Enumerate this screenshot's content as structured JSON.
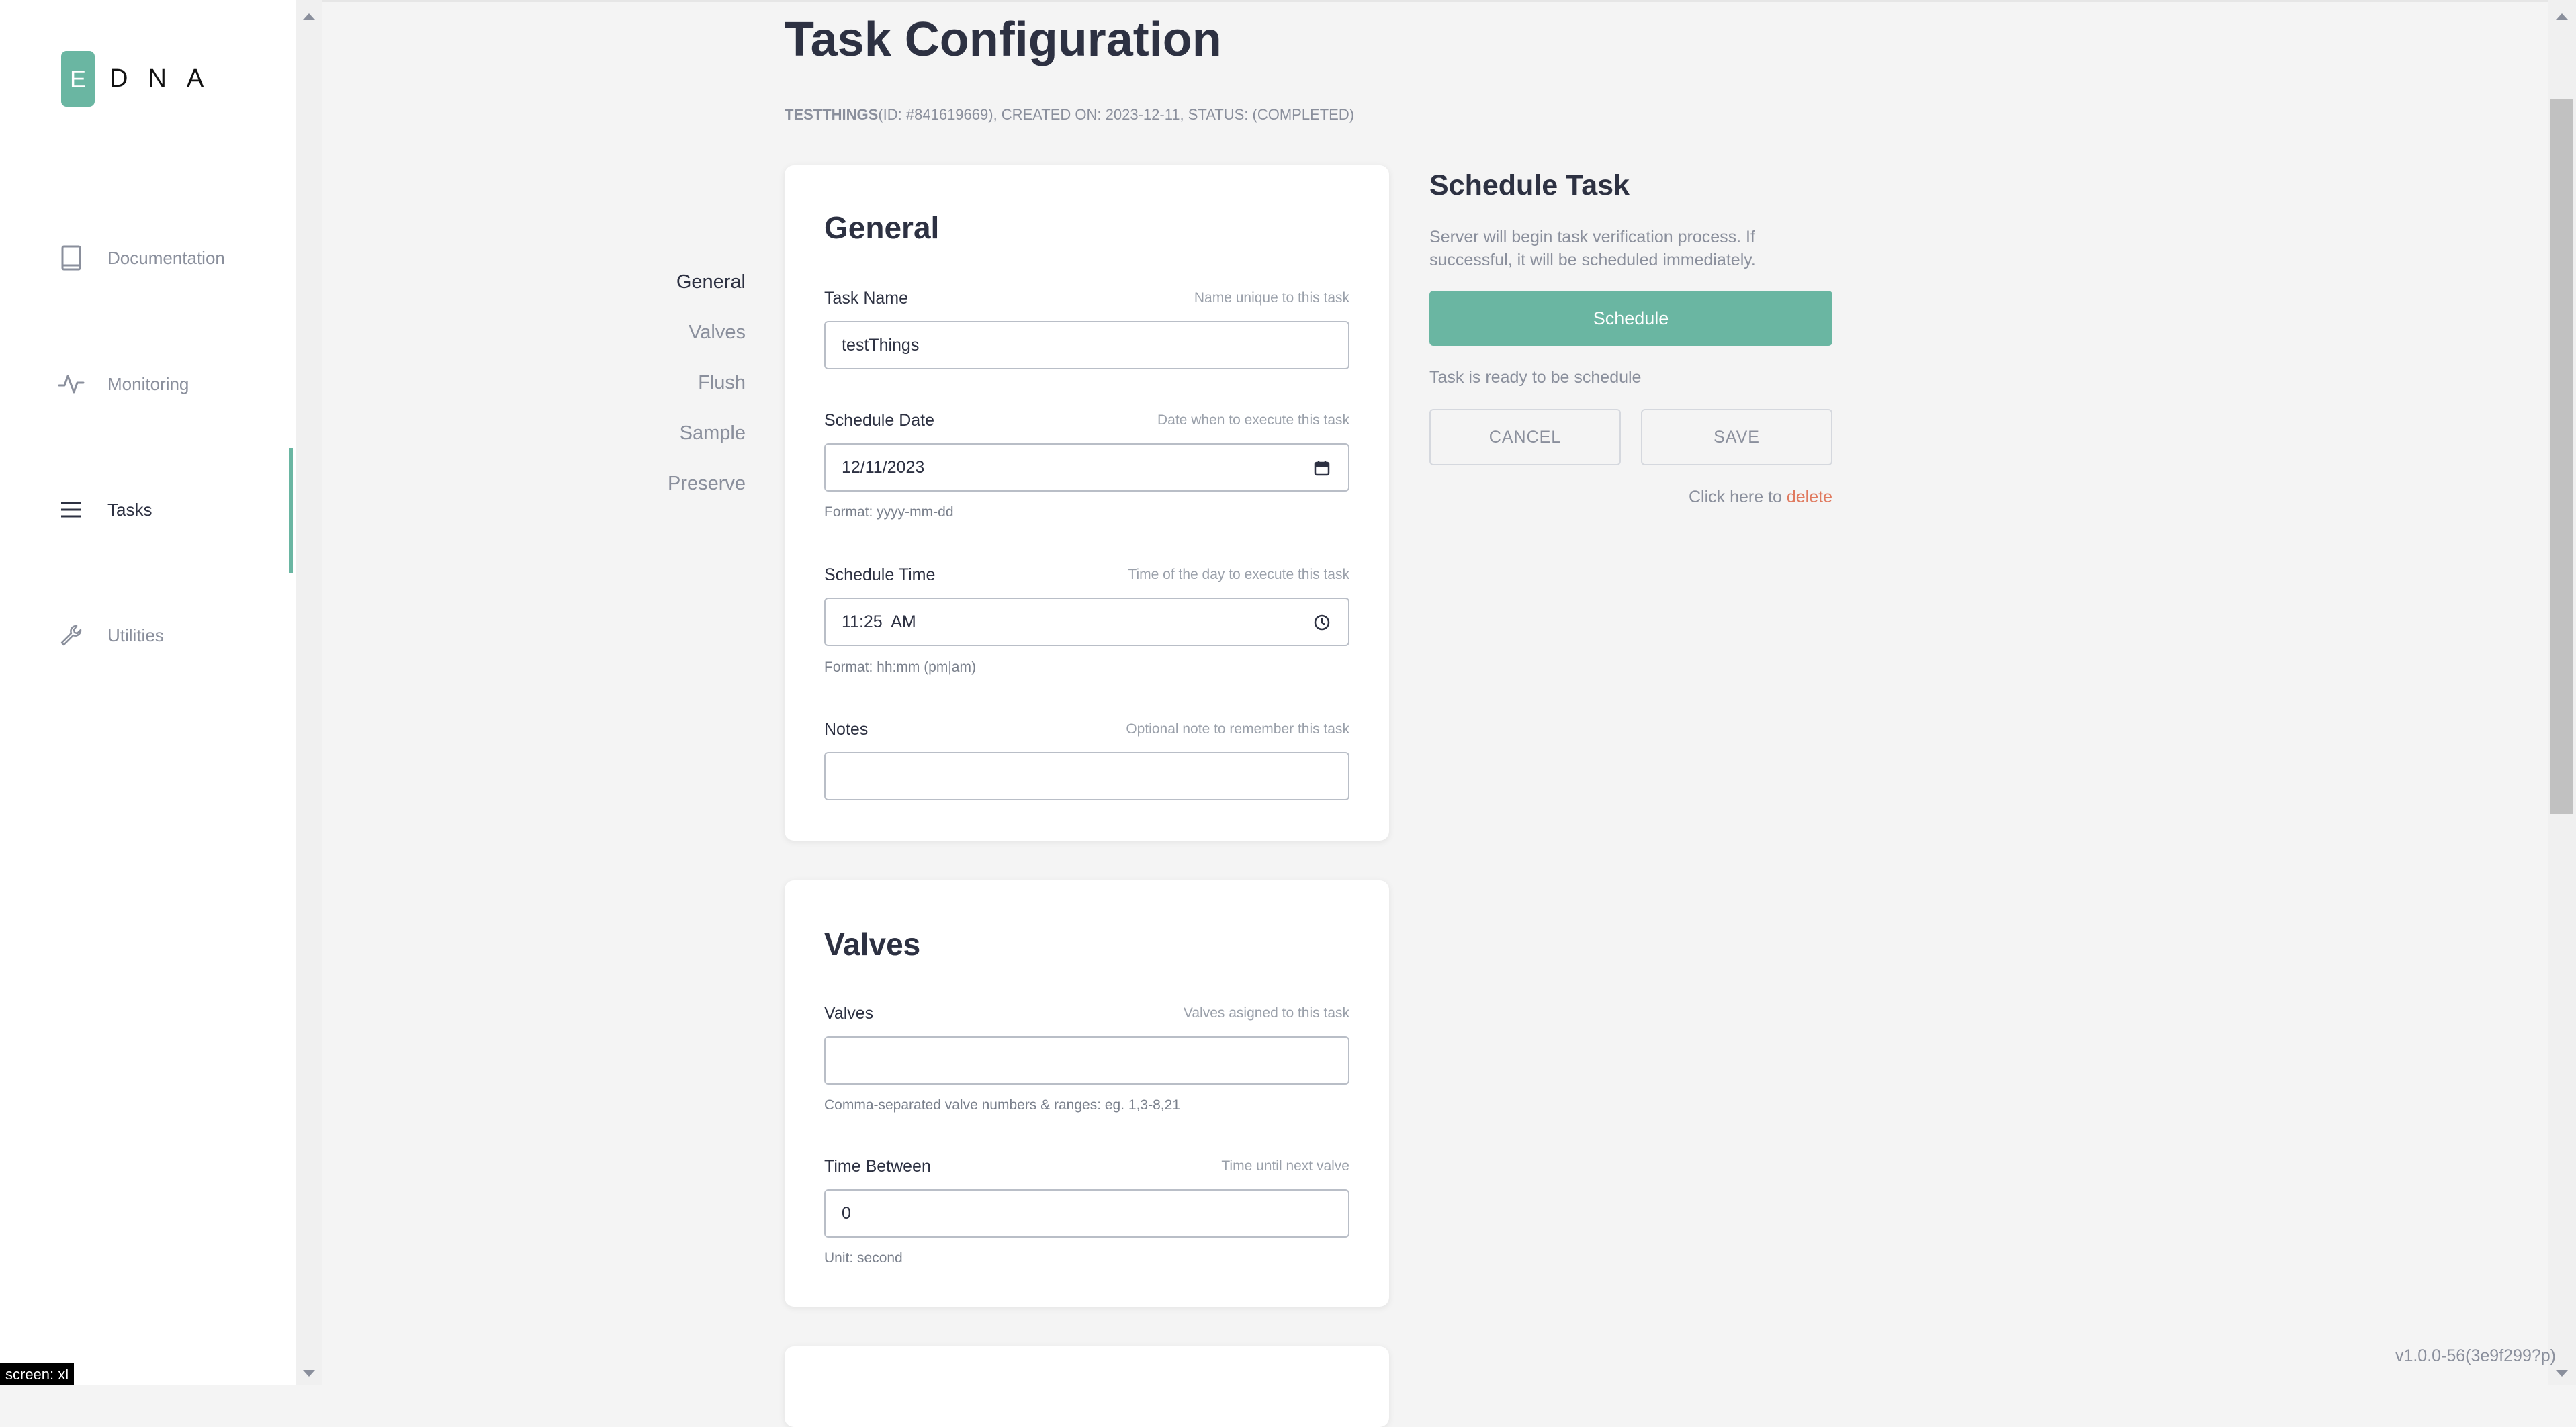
{
  "brand": {
    "badge_letter": "E",
    "rest": "DNA",
    "accent": "#6ab6a2"
  },
  "sidebar": {
    "items": [
      {
        "label": "Documentation",
        "icon": "book-icon",
        "active": false
      },
      {
        "label": "Monitoring",
        "icon": "pulse-icon",
        "active": false
      },
      {
        "label": "Tasks",
        "icon": "menu-lines-icon",
        "active": true
      },
      {
        "label": "Utilities",
        "icon": "wrench-icon",
        "active": false
      }
    ]
  },
  "header": {
    "title": "Task Configuration",
    "task_name": "TESTTHINGS",
    "meta_rest": "(ID: #841619669), CREATED ON: 2023-12-11, STATUS: (COMPLETED)"
  },
  "section_nav": [
    "General",
    "Valves",
    "Flush",
    "Sample",
    "Preserve"
  ],
  "general": {
    "title": "General",
    "task_name": {
      "label": "Task Name",
      "hint": "Name unique to this task",
      "value": "testThings"
    },
    "schedule_date": {
      "label": "Schedule Date",
      "hint": "Date when to execute this task",
      "value": "12/11/2023",
      "help": "Format: yyyy-mm-dd"
    },
    "schedule_time": {
      "label": "Schedule Time",
      "hint": "Time of the day to execute this task",
      "value": "11:25  AM",
      "help": "Format: hh:mm (pm|am)"
    },
    "notes": {
      "label": "Notes",
      "hint": "Optional note to remember this task",
      "value": ""
    }
  },
  "valves": {
    "title": "Valves",
    "valves": {
      "label": "Valves",
      "hint": "Valves asigned to this task",
      "value": "",
      "help": "Comma-separated valve numbers & ranges: eg. 1,3-8,21"
    },
    "time_between": {
      "label": "Time Between",
      "hint": "Time until next valve",
      "value": "0",
      "help": "Unit: second"
    }
  },
  "schedule": {
    "title": "Schedule Task",
    "description": "Server will begin task verification process. If successful, it will be scheduled immediately.",
    "button": "Schedule",
    "status": "Task is ready to be schedule",
    "cancel": "CANCEL",
    "save": "SAVE",
    "delete_prefix": "Click here to ",
    "delete_link": "delete"
  },
  "footer": {
    "version": "v1.0.0-56(3e9f299?p)",
    "screen_tag": "screen: xl"
  }
}
